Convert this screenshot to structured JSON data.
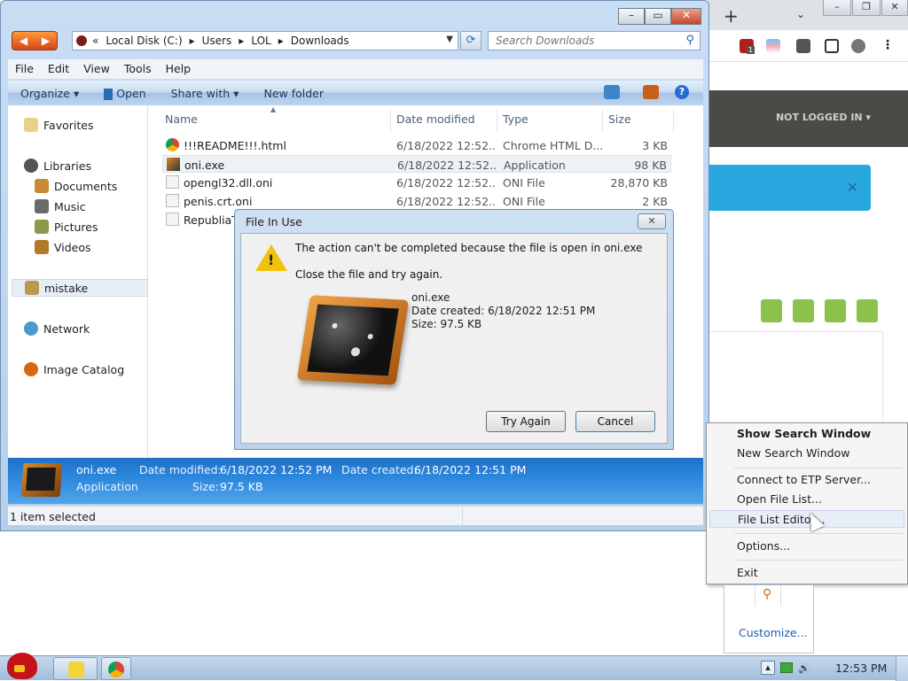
{
  "explorer": {
    "address_crumbs": [
      "«",
      "Local Disk (C:)",
      "Users",
      "LOL",
      "Downloads"
    ],
    "search_placeholder": "Search Downloads",
    "menu": [
      "File",
      "Edit",
      "View",
      "Tools",
      "Help"
    ],
    "commands": {
      "organize": "Organize ▾",
      "open": "Open",
      "share": "Share with ▾",
      "new_folder": "New folder"
    },
    "nav": {
      "favorites": "Favorites",
      "libraries": "Libraries",
      "documents": "Documents",
      "music": "Music",
      "pictures": "Pictures",
      "videos": "Videos",
      "mistake": "mistake",
      "network": "Network",
      "image_catalog": "Image Catalog"
    },
    "columns": {
      "name": "Name",
      "date": "Date modified",
      "type": "Type",
      "size": "Size"
    },
    "files": [
      {
        "name": "!!!README!!!.html",
        "date": "6/18/2022 12:52...",
        "type": "Chrome HTML D...",
        "size": "3 KB",
        "icon": "chrome-icon"
      },
      {
        "name": "oni.exe",
        "date": "6/18/2022 12:52...",
        "type": "Application",
        "size": "98 KB",
        "icon": "exe-icon"
      },
      {
        "name": "opengl32.dll.oni",
        "date": "6/18/2022 12:52...",
        "type": "ONI File",
        "size": "28,870 KB",
        "icon": "file-icon"
      },
      {
        "name": "penis.crt.oni",
        "date": "6/18/2022 12:52...",
        "type": "ONI File",
        "size": "2 KB",
        "icon": "file-icon"
      },
      {
        "name": "RepubliaT",
        "date": "",
        "type": "",
        "size": "",
        "icon": "file-icon"
      }
    ],
    "details": {
      "name": "oni.exe",
      "type": "Application",
      "modified_label": "Date modified:",
      "modified_value": "6/18/2022 12:52 PM",
      "created_label": "Date created:",
      "created_value": "6/18/2022 12:51 PM",
      "size_label": "Size:",
      "size_value": "97.5 KB"
    },
    "status": "1 item selected"
  },
  "dialog": {
    "title": "File In Use",
    "message": "The action can't be completed because the file is open in oni.exe",
    "hint": "Close the file and try again.",
    "file_name": "oni.exe",
    "file_created": "Date created: 6/18/2022 12:51 PM",
    "file_size": "Size: 97.5 KB",
    "try_again": "Try Again",
    "cancel": "Cancel"
  },
  "context_menu": {
    "items": [
      "Show Search Window",
      "New Search Window",
      "Connect to ETP Server...",
      "Open File List...",
      "File List Editor...",
      "Options...",
      "Exit"
    ]
  },
  "browser": {
    "not_logged_in": "NOT LOGGED IN ▾",
    "tab_count_badge": "1"
  },
  "tray": {
    "customize": "Customize...",
    "time": "12:53 PM"
  },
  "colors": {
    "accent_blue": "#2a86dc",
    "alert_blue": "#29a8e0",
    "dark_header": "#4a4a46",
    "green_icons": "#8bc34a"
  }
}
